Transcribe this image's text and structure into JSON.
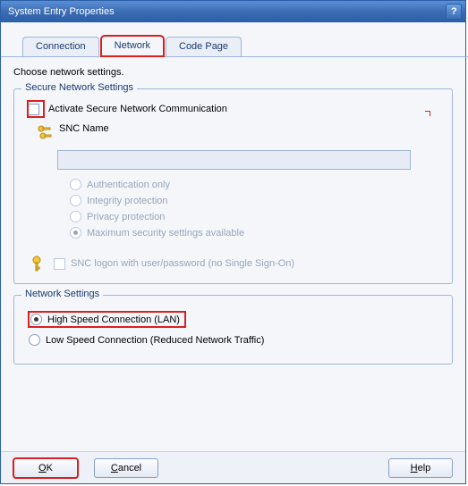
{
  "title": "System Entry Properties",
  "tabs": {
    "connection": "Connection",
    "network": "Network",
    "codepage": "Code Page"
  },
  "instruction": "Choose network settings.",
  "secure_group": {
    "legend": "Secure Network Settings",
    "activate": "Activate Secure Network Communication",
    "snc_name_label": "SNC Name",
    "snc_name_value": "",
    "opt_auth": "Authentication only",
    "opt_integrity": "Integrity protection",
    "opt_privacy": "Privacy protection",
    "opt_max": "Maximum security settings available",
    "snc_logon": "SNC logon with user/password (no Single Sign-On)"
  },
  "network_group": {
    "legend": "Network Settings",
    "opt_high": "High Speed Connection (LAN)",
    "opt_low": "Low Speed Connection (Reduced Network Traffic)"
  },
  "buttons": {
    "ok": "OK",
    "ok_u": "O",
    "ok_rest": "K",
    "cancel": "Cancel",
    "cancel_u": "C",
    "cancel_rest": "ancel",
    "help": "Help",
    "help_u": "H",
    "help_rest": "elp"
  }
}
